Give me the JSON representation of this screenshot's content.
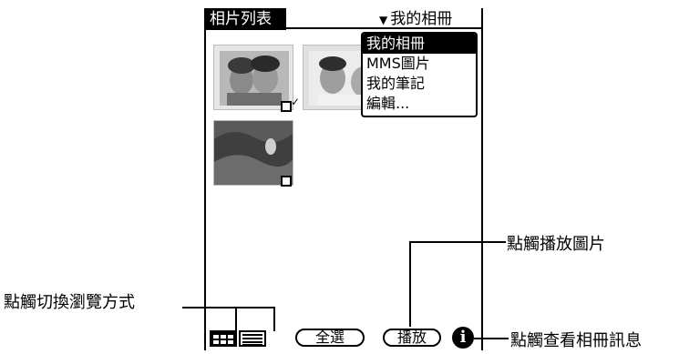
{
  "app": {
    "title": "相片列表",
    "album_selector": {
      "current": "我的相冊",
      "arrow_icon": "triangle-down-icon"
    }
  },
  "dropdown": {
    "items": [
      {
        "label": "我的相冊",
        "selected": true
      },
      {
        "label": "MMS圖片",
        "selected": false
      },
      {
        "label": "我的筆記",
        "selected": false
      },
      {
        "label": "編輯...",
        "selected": false
      }
    ]
  },
  "photos": [
    {
      "name": "photo-1",
      "checked": true
    },
    {
      "name": "photo-2",
      "checked": false
    },
    {
      "name": "photo-3",
      "checked": false
    }
  ],
  "bottom_bar": {
    "view_buttons": [
      "thumbnail-view-icon",
      "list-view-icon"
    ],
    "select_all_label": "全選",
    "play_label": "播放",
    "info_icon": "info-icon",
    "info_glyph": "i"
  },
  "annotations": {
    "play": "點觸播放圖片",
    "view_toggle": "點觸切換瀏覽方式",
    "info": "點觸查看相冊訊息"
  }
}
